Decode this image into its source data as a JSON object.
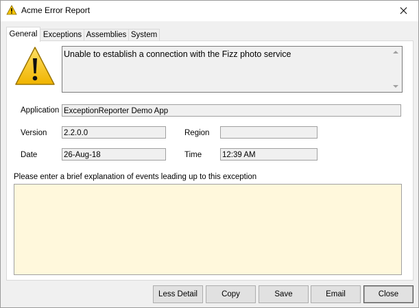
{
  "window": {
    "title": "Acme Error Report",
    "icon": "warning-icon"
  },
  "tabs": [
    {
      "label": "General",
      "active": true
    },
    {
      "label": "Exceptions",
      "active": false
    },
    {
      "label": "Assemblies",
      "active": false
    },
    {
      "label": "System",
      "active": false
    }
  ],
  "general": {
    "message": "Unable to establish a connection with the Fizz photo service",
    "application_label": "Application",
    "application_value": "ExceptionReporter Demo App",
    "version_label": "Version",
    "version_value": "2.2.0.0",
    "region_label": "Region",
    "region_value": "",
    "date_label": "Date",
    "date_value": "26-Aug-18",
    "time_label": "Time",
    "time_value": "12:39 AM",
    "explanation_prompt": "Please enter a brief explanation of events leading up to this exception",
    "explanation_value": ""
  },
  "buttons": {
    "less_detail": "Less Detail",
    "copy": "Copy",
    "save": "Save",
    "email": "Email",
    "close": "Close"
  },
  "colors": {
    "explanation_background": "#fff8dc",
    "readonly_background": "#f0f0f0",
    "warning_yellow": "#f5c400"
  }
}
